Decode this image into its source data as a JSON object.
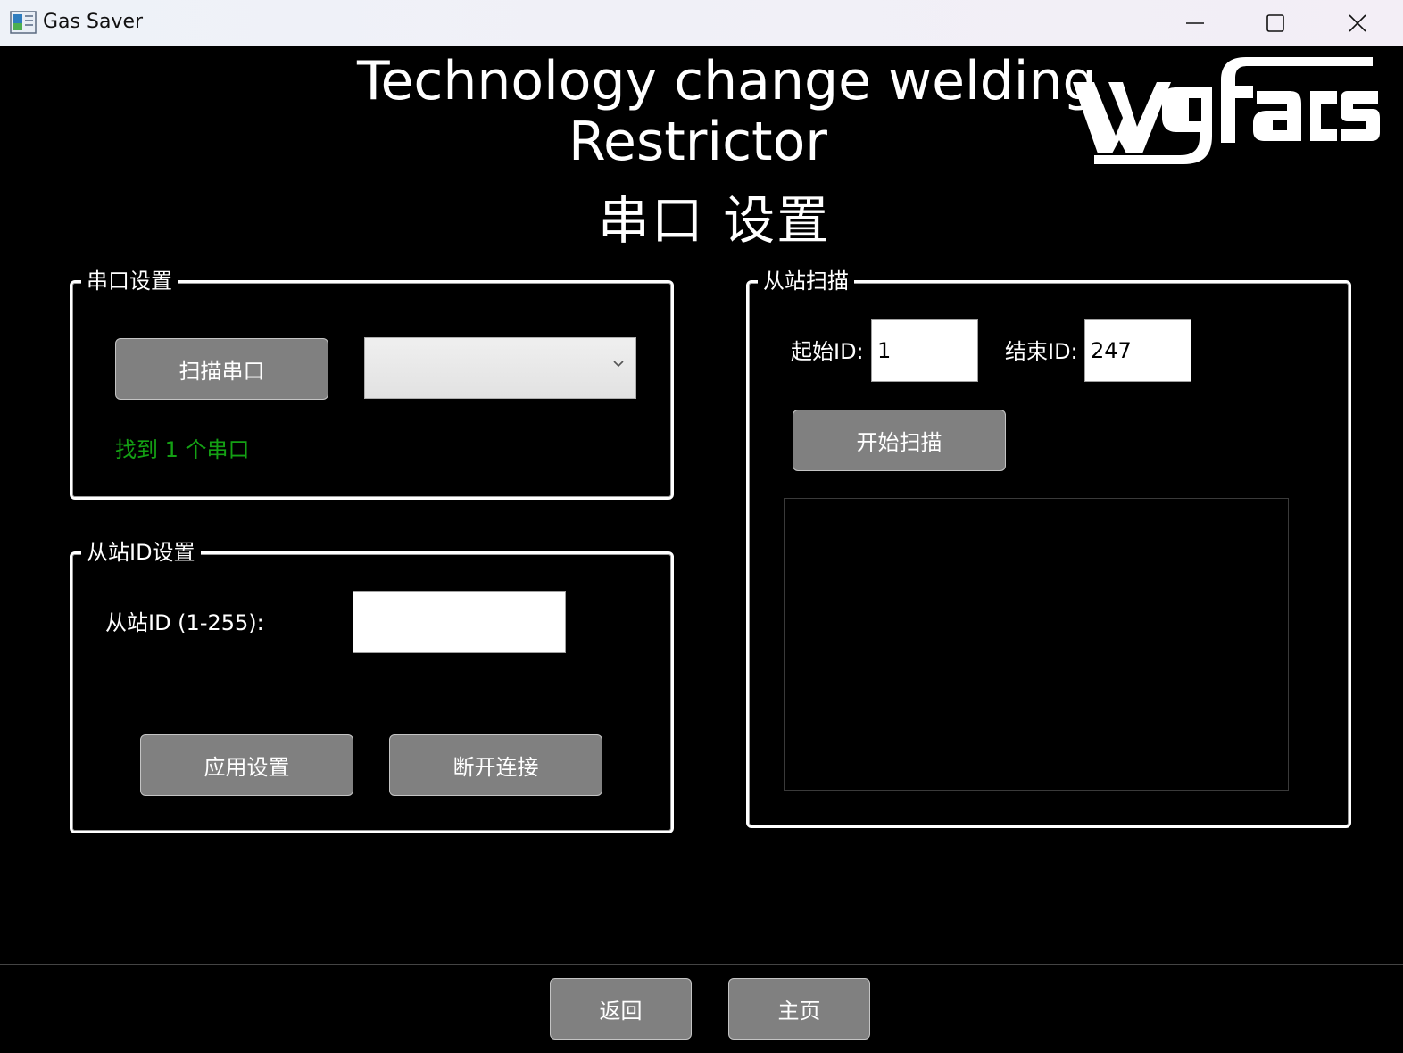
{
  "window": {
    "title": "Gas Saver",
    "controls": [
      "minimize",
      "maximize",
      "close"
    ]
  },
  "header": {
    "title_line1": "Technology change welding",
    "title_line2": "Restrictor",
    "logo_text": "wgfacs"
  },
  "page_title": "串口 设置",
  "serial_group": {
    "legend": "串口设置",
    "scan_button": "扫描串口",
    "port_select": {
      "selected": ""
    },
    "status": "找到 1 个串口"
  },
  "slave_group": {
    "legend": "从站ID设置",
    "id_label": "从站ID (1-255):",
    "id_value": "",
    "apply_button": "应用设置",
    "disconnect_button": "断开连接"
  },
  "scan_group": {
    "legend": "从站扫描",
    "start_label": "起始ID:",
    "start_value": "1",
    "end_label": "结束ID:",
    "end_value": "247",
    "start_button": "开始扫描",
    "results": []
  },
  "footer": {
    "back_button": "返回",
    "home_button": "主页"
  },
  "colors": {
    "background": "#000000",
    "button": "#808080",
    "status_ok": "#14a014"
  }
}
